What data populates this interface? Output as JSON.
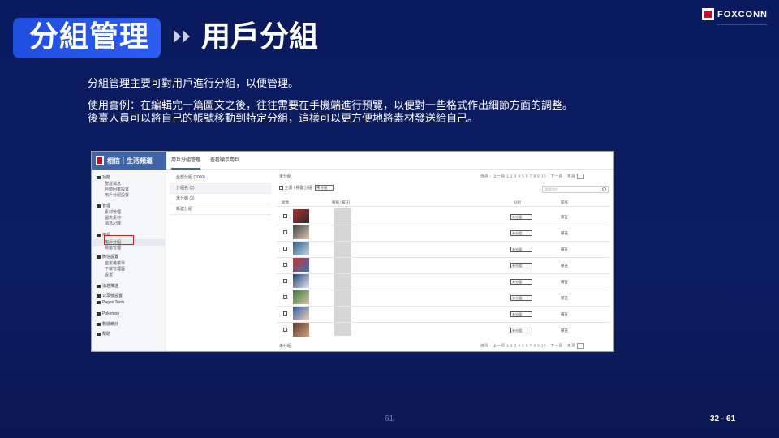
{
  "header": {
    "title": "分組管理",
    "subtitle": "用戶分組"
  },
  "logo": {
    "name": "FOXCONN",
    "tagline": "——————————————"
  },
  "body": {
    "line1": "分組管理主要可對用戶進行分組，以便管理。",
    "line2": "使用實例：在編輯完一篇圖文之後，往往需要在手機端進行預覽，以便對一些格式作出細節方面的調整。",
    "line3": "後臺人員可以將自己的帳號移動到特定分組，這樣可以更方便地將素材發送給自己。"
  },
  "screenshot": {
    "brand": "相信｜生活頻道",
    "tabs": [
      "用戶分組管理",
      "查看顯示用戶"
    ],
    "nav": {
      "groups": [
        {
          "label": "功能",
          "items": [
            "群發消息",
            "自動回復設置",
            "用戶分組設置"
          ]
        },
        {
          "label": "管理",
          "items": [
            "素材管理",
            "圖表素材",
            "消息記錄"
          ]
        },
        {
          "label": "用戶",
          "items": [
            "用戶分組",
            "標籤管理"
          ]
        },
        {
          "label": "微信設置",
          "items": [
            "自定義菜單",
            "下載管理器",
            "設置"
          ]
        }
      ],
      "extra": [
        "消息推送",
        "公眾號設置",
        "Pages Tools",
        "Pokemon",
        "數據統計",
        "幫助"
      ]
    },
    "group_list": [
      "全部分組 (3000)",
      "分組名 (2)",
      "未分組 (3)",
      "新建分組"
    ],
    "main": {
      "title": "未分組",
      "pager_top": "首頁 · 上一頁 1 2 3 4 5 6 7 8 9 10 · 下一頁 · 末頁",
      "pager_bottom": "首頁 · 上一頁 1 2 3 4 5 6 7 8 9 10 · 下一頁 · 末頁",
      "filter_label": "全選 / 移動分組",
      "filter_value": "未分組",
      "search_placeholder": "搜索用戶",
      "columns": [
        "頭像",
        "暱稱 (備註)",
        "分組",
        "操作"
      ],
      "row_group_value": "未分組",
      "row_action": "備註",
      "rows": 8,
      "footer": "未分組"
    }
  },
  "page_number": "61",
  "page_range": "32 - 61"
}
